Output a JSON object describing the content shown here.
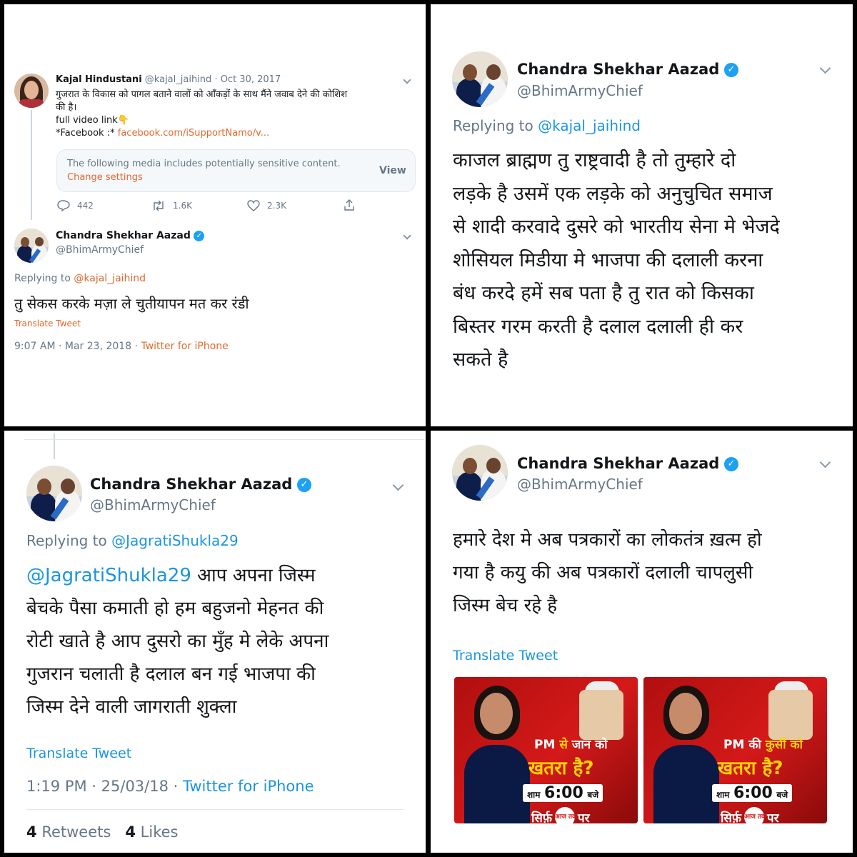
{
  "panel1": {
    "quoted": {
      "name": "Kajal Hindustani",
      "handle": "@kajal_jaihind",
      "date": "· Oct 30, 2017",
      "text_line1": "गुजरात के विकास को पागल बताने वालों को आँकड़ों के साथ मैंने जवाब देने की कोशिश",
      "text_line2": "की है।",
      "video_label": "full video link👇",
      "facebook_prefix": "*Facebook :*",
      "facebook_link": "facebook.com/iSupportNamo/v...",
      "sensitive_text": "The following media includes potentially sensitive content.",
      "change_settings": "Change settings",
      "view_label": "View",
      "replies": "442",
      "retweets": "1.6K",
      "likes": "2.3K"
    },
    "reply": {
      "name": "Chandra Shekhar Aazad",
      "handle": "@BhimArmyChief",
      "replying_to_prefix": "Replying to",
      "replying_to": "@kajal_jaihind",
      "text": "तु सेकस करके मज़ा ले चुतीयापन मत कर रंडी",
      "translate": "Translate Tweet",
      "timestamp": "9:07 AM · Mar 23, 2018 ·",
      "source": "Twitter for iPhone"
    }
  },
  "panel2": {
    "name": "Chandra Shekhar Aazad",
    "handle": "@BhimArmyChief",
    "replying_to_prefix": "Replying to",
    "replying_to": "@kajal_jaihind",
    "lines": [
      "काजल ब्राह्मण तु राष्ट्रवादी है तो तुम्हारे दो",
      "लड़के है उसमें एक लड़के को अनुचुचित समाज",
      "से शादी करवादे दुसरे को भारतीय सेना मे भेजदे",
      "शोसियल मिडीया मे भाजपा की दलाली करना",
      "बंध करदे हमें सब पता है तु रात को किसका",
      "बिस्तर गरम करती है दलाल दलाली ही कर",
      "सकते है"
    ]
  },
  "panel3": {
    "name": "Chandra Shekhar Aazad",
    "handle": "@BhimArmyChief",
    "replying_to_prefix": "Replying to",
    "replying_to": "@JagratiShukla29",
    "mention": "@JagratiShukla29",
    "line1_rest": " आप अपना जिस्म",
    "lines": [
      "बेचके पैसा कमाती हो हम बहुजनो मेहनत की",
      "रोटी खाते है आप दुसरो का मुँह मे लेके अपना",
      "गुजरान चलाती है दलाल बन गई भाजपा की",
      "जिस्म देने वाली जागराती शुक्ला"
    ],
    "translate": "Translate Tweet",
    "timestamp": "1:19 PM · 25/03/18 ·",
    "source": "Twitter for iPhone",
    "retweets_count": "4",
    "retweets_label": "Retweets",
    "likes_count": "4",
    "likes_label": "Likes"
  },
  "panel4": {
    "name": "Chandra Shekhar Aazad",
    "handle": "@BhimArmyChief",
    "lines": [
      "हमारे देश मे अब पत्रकारों का लोकतंत्र ख़त्म हो",
      "गया है कयु की अब पत्रकारों दलाली चापलुसी",
      "जिस्म बेच रहे है"
    ],
    "translate": "Translate Tweet",
    "images": [
      {
        "line1_a": "PM",
        "line1_b": "से",
        "line1_c": "जान को",
        "line2": "खतरा है?",
        "time_prefix": "शाम",
        "time": "6:00",
        "time_suffix": "बजे",
        "line4": "सिर्फ़",
        "logo": "आज तक",
        "line4_suffix": "पर"
      },
      {
        "line1_a": "PM",
        "line1_b": "की",
        "line1_c": "कुर्सी को",
        "line2": "खतरा है?",
        "time_prefix": "शाम",
        "time": "6:00",
        "time_suffix": "बजे",
        "line4": "सिर्फ़",
        "logo": "आज तक",
        "line4_suffix": "पर"
      }
    ]
  },
  "colors": {
    "link": "#1b95e0",
    "orange_link": "#e0692d",
    "verified": "#1da1f2",
    "secondary": "#657786",
    "news_red": "#d41919",
    "news_yellow": "#ffd400"
  }
}
